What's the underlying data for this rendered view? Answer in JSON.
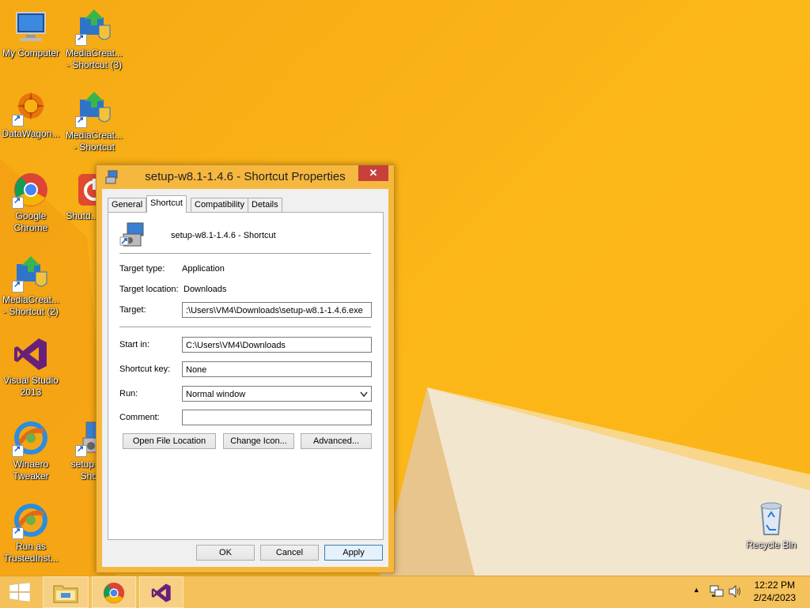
{
  "desktop": {
    "icons": [
      {
        "label": "My Computer"
      },
      {
        "label": "MediaCreat... - Shortcut (3)"
      },
      {
        "label": "DataWagon..."
      },
      {
        "label": "MediaCreat... - Shortcut"
      },
      {
        "label": "Google Chrome"
      },
      {
        "label": "Shutd... (ful..."
      },
      {
        "label": "MediaCreat... - Shortcut (2)"
      },
      {
        "label": "Visual Studio 2013"
      },
      {
        "label": "Winaero Tweaker"
      },
      {
        "label": "setup-w... - Shor..."
      },
      {
        "label": "Run as TrustedInst..."
      },
      {
        "label": "Recycle Bin"
      }
    ]
  },
  "dialog": {
    "title": "setup-w8.1-1.4.6 - Shortcut Properties",
    "close": "✕",
    "tabs": [
      {
        "label": "General"
      },
      {
        "label": "Shortcut"
      },
      {
        "label": "Compatibility"
      },
      {
        "label": "Details"
      }
    ],
    "shortcut_name": "setup-w8.1-1.4.6 - Shortcut",
    "target_type_label": "Target type:",
    "target_type_value": "Application",
    "target_location_label": "Target location:",
    "target_location_value": "Downloads",
    "target_label": "Target:",
    "target_value": ":\\Users\\VM4\\Downloads\\setup-w8.1-1.4.6.exe",
    "start_in_label": "Start in:",
    "start_in_value": "C:\\Users\\VM4\\Downloads",
    "shortcut_key_label": "Shortcut key:",
    "shortcut_key_value": "None",
    "run_label": "Run:",
    "run_value": "Normal window",
    "comment_label": "Comment:",
    "comment_value": "",
    "buttons": {
      "open_file_location": "Open File Location",
      "change_icon": "Change Icon...",
      "advanced": "Advanced...",
      "ok": "OK",
      "cancel": "Cancel",
      "apply": "Apply"
    }
  },
  "taskbar": {
    "time": "12:22 PM",
    "date": "2/24/2023",
    "tray_arrow": "▲"
  }
}
